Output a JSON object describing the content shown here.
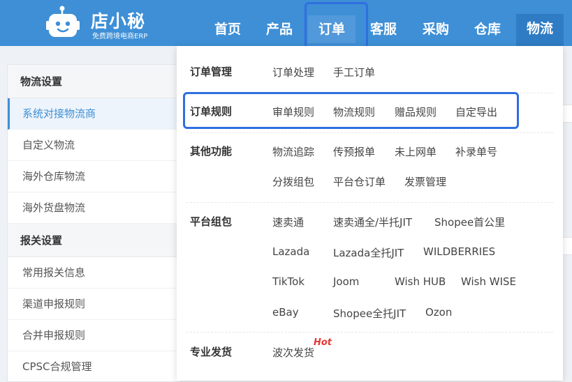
{
  "logo": {
    "icon": "robot-logo-icon",
    "title": "店小秘",
    "subtitle": "免费跨境电商ERP"
  },
  "nav": {
    "home": "首页",
    "product": "产品",
    "order": "订单",
    "service": "客服",
    "purchase": "采购",
    "warehouse": "仓库",
    "logistics": "物流"
  },
  "sidebar": {
    "groups": [
      {
        "title": "物流设置",
        "items": [
          "系统对接物流商",
          "自定义物流",
          "海外仓库物流",
          "海外货盘物流"
        ]
      },
      {
        "title": "报关设置",
        "items": [
          "常用报关信息",
          "渠道申报规则",
          "合并申报规则",
          "CPSC合规管理"
        ]
      }
    ],
    "active_item": "系统对接物流商"
  },
  "menu": {
    "order_mgmt": {
      "label": "订单管理",
      "links": [
        "订单处理",
        "手工订单"
      ]
    },
    "order_rules": {
      "label": "订单规则",
      "links": [
        "审单规则",
        "物流规则",
        "赠品规则",
        "自定导出"
      ]
    },
    "other": {
      "label": "其他功能",
      "links": [
        "物流追踪",
        "传预报单",
        "未上网单",
        "补录单号",
        "分拨组包",
        "平台仓订单",
        "发票管理"
      ]
    },
    "platform": {
      "label": "平台组包",
      "links": [
        "速卖通",
        "速卖通全/半托JIT",
        "Shopee首公里",
        "Lazada",
        "Lazada全托JIT",
        "WILDBERRIES",
        "TikTok",
        "Joom",
        "Wish HUB",
        "Wish WISE",
        "eBay",
        "Shopee全托JIT",
        "Ozon"
      ]
    },
    "pro": {
      "label": "专业发货",
      "links": [
        "波次发货"
      ],
      "badge": "Hot"
    }
  },
  "colors": {
    "header": "#3e8fd6",
    "highlight": "#2f6fe0",
    "hot": "#e53935"
  }
}
